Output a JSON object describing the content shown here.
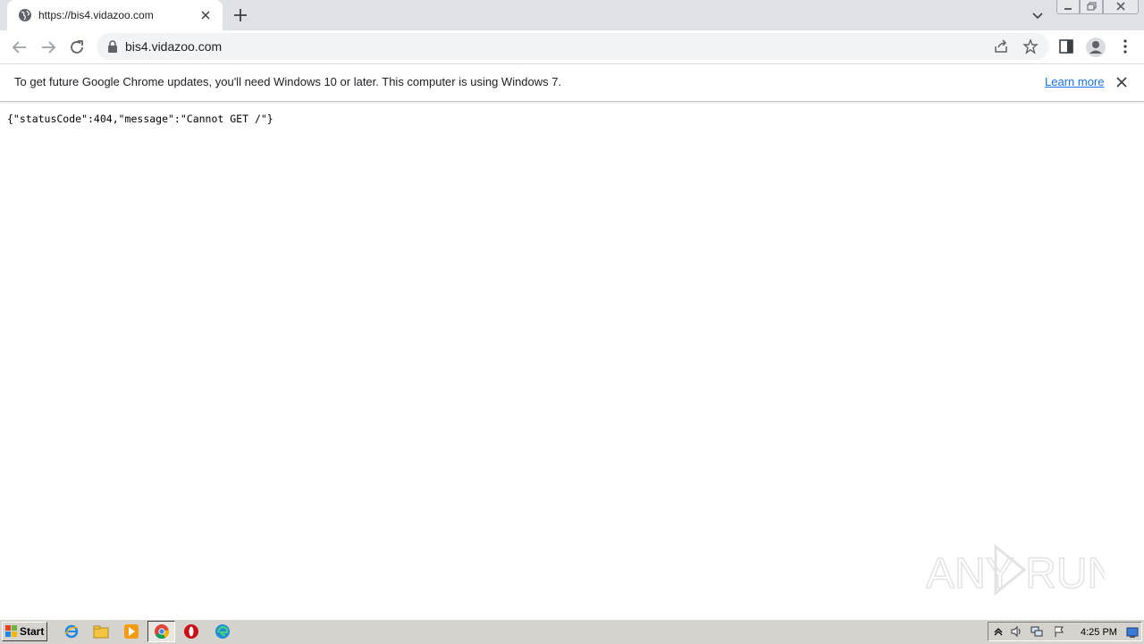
{
  "browser": {
    "tab": {
      "title": "https://bis4.vidazoo.com",
      "favicon": "globe-icon"
    },
    "address_bar": {
      "url": "bis4.vidazoo.com",
      "security": "lock-icon"
    }
  },
  "infobar": {
    "message": "To get future Google Chrome updates, you'll need Windows 10 or later. This computer is using Windows 7.",
    "link_label": "Learn more",
    "link_color": "#1a73e8"
  },
  "page": {
    "body_text": "{\"statusCode\":404,\"message\":\"Cannot GET /\"}"
  },
  "watermark": {
    "text": "ANY RUN"
  },
  "taskbar": {
    "start_label": "Start",
    "apps": [
      "internet-explorer-icon",
      "folder-icon",
      "media-player-icon",
      "chrome-icon",
      "opera-icon",
      "edge-icon"
    ],
    "tray_icons": [
      "show-hidden-icons",
      "volume-icon",
      "network-icon",
      "action-center-flag-icon"
    ],
    "clock": "4:25 PM"
  }
}
